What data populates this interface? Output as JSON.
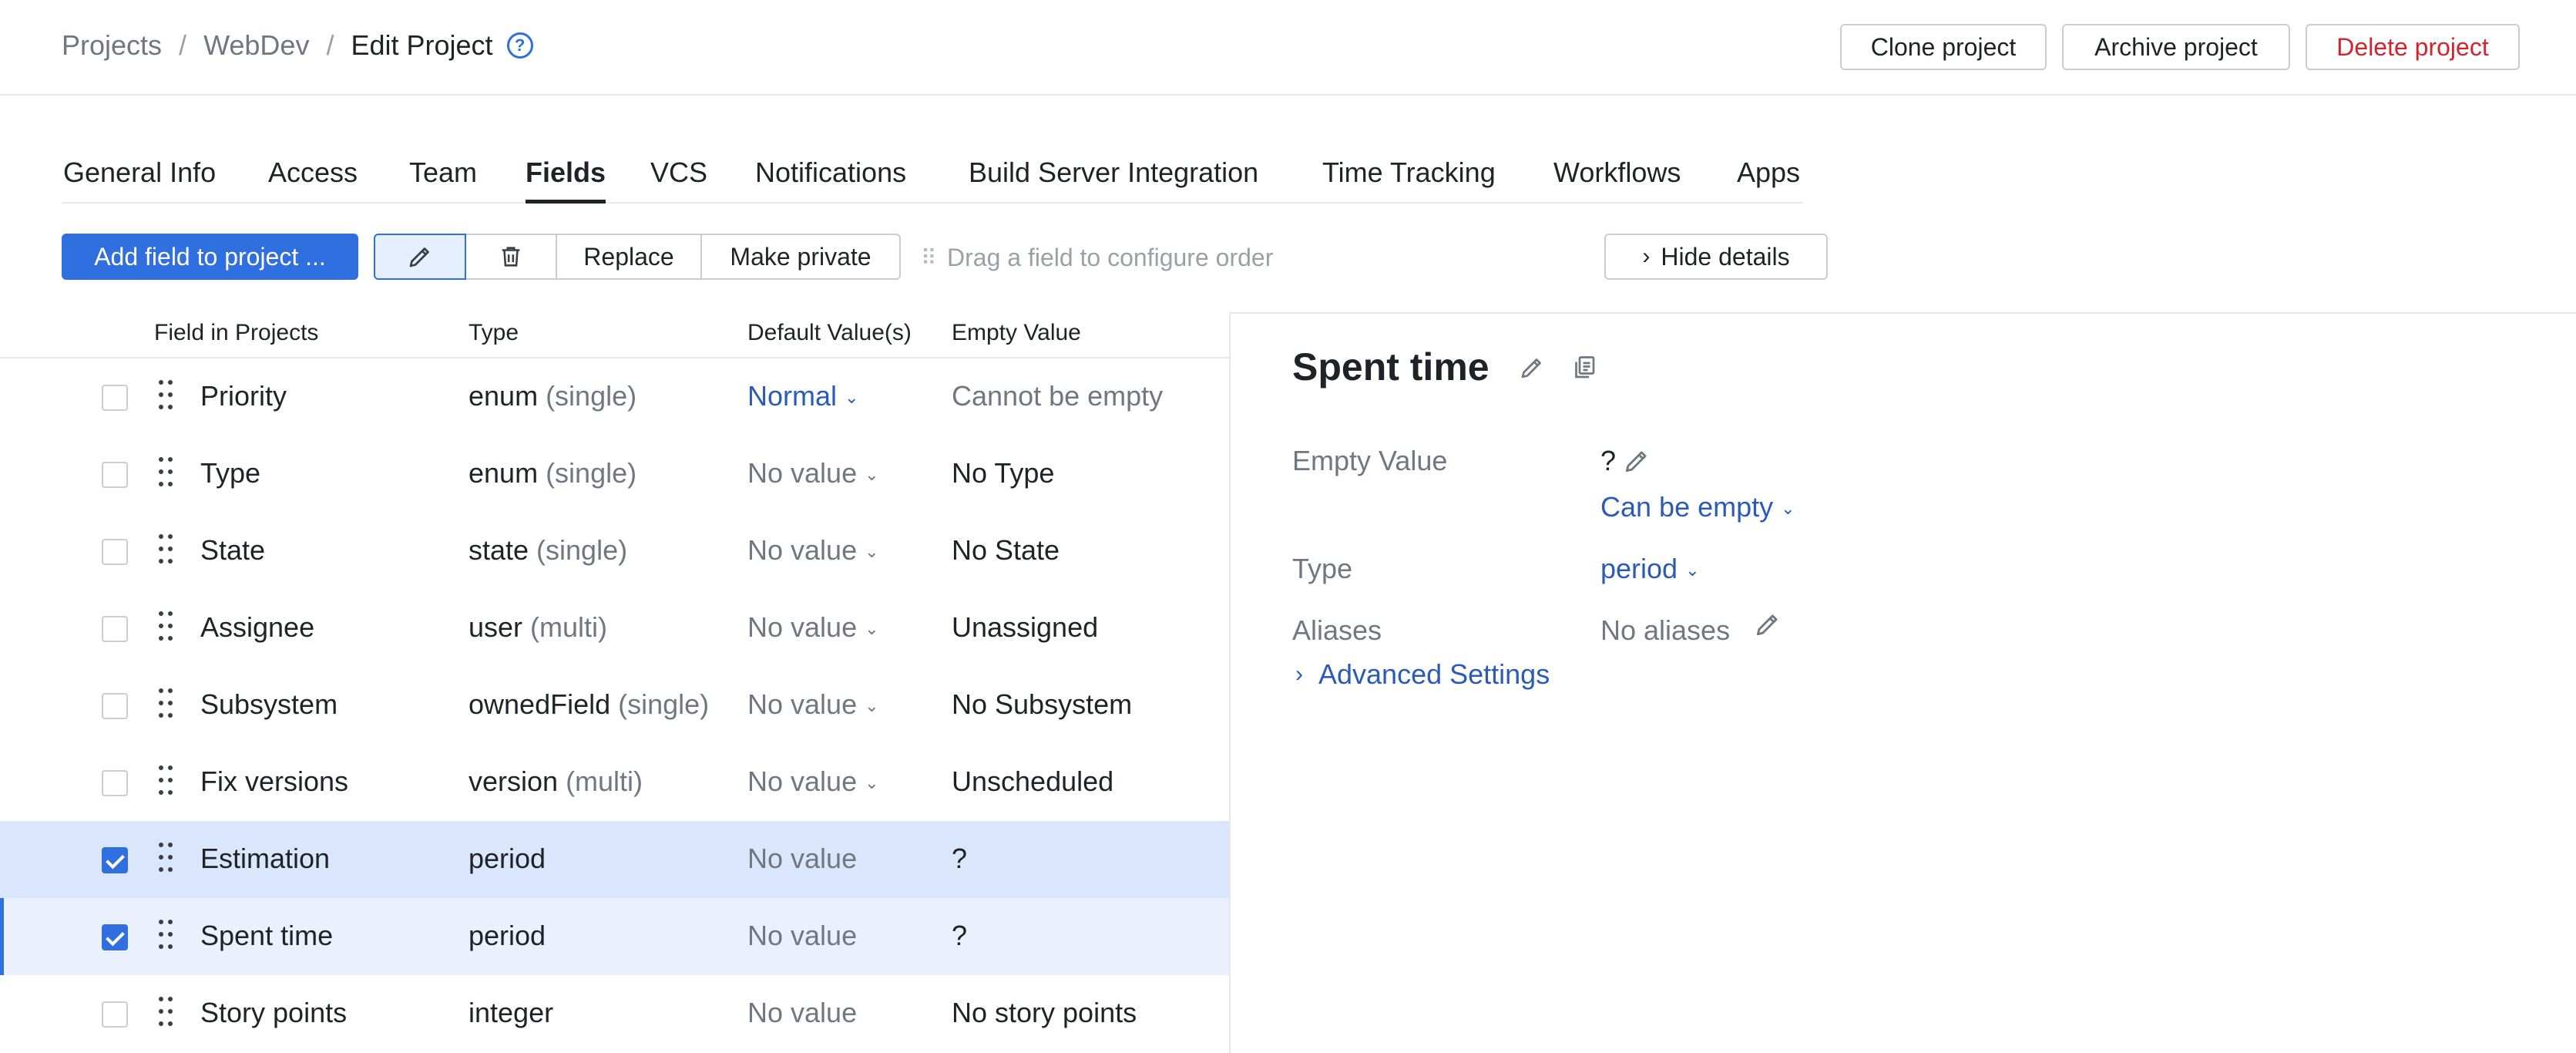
{
  "breadcrumb": {
    "items": [
      "Projects",
      "WebDev"
    ],
    "current": "Edit Project",
    "separator": "/",
    "help_icon": "help-circle-icon"
  },
  "header_actions": {
    "clone": "Clone project",
    "archive": "Archive project",
    "delete": "Delete project"
  },
  "tabs": [
    {
      "label": "General Info",
      "active": false
    },
    {
      "label": "Access",
      "active": false
    },
    {
      "label": "Team",
      "active": false
    },
    {
      "label": "Fields",
      "active": true
    },
    {
      "label": "VCS",
      "active": false
    },
    {
      "label": "Notifications",
      "active": false
    },
    {
      "label": "Build Server Integration",
      "active": false
    },
    {
      "label": "Time Tracking",
      "active": false
    },
    {
      "label": "Workflows",
      "active": false
    },
    {
      "label": "Apps",
      "active": false
    }
  ],
  "toolbar": {
    "add_field": "Add field to project ...",
    "edit_icon": "pencil-icon",
    "delete_icon": "trash-icon",
    "replace": "Replace",
    "make_private": "Make private",
    "drag_hint": "Drag a field to configure order",
    "hide_details": "Hide details"
  },
  "table": {
    "headers": {
      "field": "Field in Projects",
      "type": "Type",
      "default": "Default Value(s)",
      "empty": "Empty Value"
    },
    "rows": [
      {
        "name": "Priority",
        "type": "enum",
        "type_qual": "(single)",
        "default": "Normal",
        "default_dropdown": true,
        "default_link": true,
        "empty": "Cannot be empty",
        "empty_muted": true,
        "checked": false
      },
      {
        "name": "Type",
        "type": "enum",
        "type_qual": "(single)",
        "default": "No value",
        "default_dropdown": true,
        "default_link": false,
        "empty": "No Type",
        "empty_muted": false,
        "checked": false
      },
      {
        "name": "State",
        "type": "state",
        "type_qual": "(single)",
        "default": "No value",
        "default_dropdown": true,
        "default_link": false,
        "empty": "No State",
        "empty_muted": false,
        "checked": false
      },
      {
        "name": "Assignee",
        "type": "user",
        "type_qual": "(multi)",
        "default": "No value",
        "default_dropdown": true,
        "default_link": false,
        "empty": "Unassigned",
        "empty_muted": false,
        "checked": false
      },
      {
        "name": "Subsystem",
        "type": "ownedField",
        "type_qual": "(single)",
        "default": "No value",
        "default_dropdown": true,
        "default_link": false,
        "empty": "No Subsystem",
        "empty_muted": false,
        "checked": false
      },
      {
        "name": "Fix versions",
        "type": "version",
        "type_qual": "(multi)",
        "default": "No value",
        "default_dropdown": true,
        "default_link": false,
        "empty": "Unscheduled",
        "empty_muted": false,
        "checked": false
      },
      {
        "name": "Estimation",
        "type": "period",
        "type_qual": "",
        "default": "No value",
        "default_dropdown": false,
        "default_link": false,
        "empty": "?",
        "empty_muted": false,
        "checked": true
      },
      {
        "name": "Spent time",
        "type": "period",
        "type_qual": "",
        "default": "No value",
        "default_dropdown": false,
        "default_link": false,
        "empty": "?",
        "empty_muted": false,
        "checked": true
      },
      {
        "name": "Story points",
        "type": "integer",
        "type_qual": "",
        "default": "No value",
        "default_dropdown": false,
        "default_link": false,
        "empty": "No story points",
        "empty_muted": false,
        "checked": false
      }
    ]
  },
  "details": {
    "title": "Spent time",
    "empty_label": "Empty Value",
    "empty_value": "?",
    "empty_mode": "Can be empty",
    "type_label": "Type",
    "type_value": "period",
    "aliases_label": "Aliases",
    "aliases_value": "No aliases",
    "advanced": "Advanced Settings"
  },
  "colors": {
    "primary": "#2f6fe0",
    "link": "#2a5bb8",
    "danger": "#d1242f",
    "selected_row": "#d9e6fb",
    "selected_row_light": "#eaf1fd"
  }
}
